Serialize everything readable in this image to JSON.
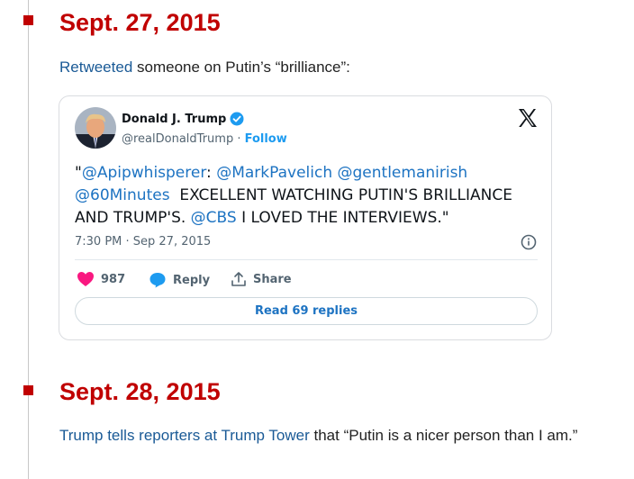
{
  "entries": [
    {
      "date": "Sept. 27, 2015",
      "link_text": "Retweeted",
      "text_after": " someone on Putin’s “brilliance”:"
    },
    {
      "date": "Sept. 28, 2015",
      "link_text": "Trump tells reporters at Trump Tower",
      "text_after": " that “Putin is a nicer person than I am.”"
    }
  ],
  "tweet": {
    "author_name": "Donald J. Trump",
    "handle": "@realDonaldTrump",
    "separator": " · ",
    "follow_label": "Follow",
    "text_open_quote": "\"",
    "mention_1": "@Apipwhisperer",
    "text_1": ": ",
    "mention_2": "@MarkPavelich",
    "text_2": " ",
    "mention_3": "@gentlemanirish",
    "text_3": " ",
    "mention_4": "@60Minutes",
    "text_4": "  EXCELLENT WATCHING PUTIN'S BRILLIANCE AND TRUMP'S. ",
    "mention_5": "@CBS",
    "text_5": " I LOVED THE INTERVIEWS.\"",
    "timestamp": "7:30 PM · Sep 27, 2015",
    "like_count": "987",
    "reply_label": "Reply",
    "share_label": "Share",
    "read_replies_label": "Read 69 replies"
  },
  "colors": {
    "date_red": "#c00000",
    "link_blue": "#1a5a96",
    "tweet_blue": "#1d9bf0",
    "like_pink": "#f91880"
  },
  "icons": [
    "verified-badge-icon",
    "x-logo-icon",
    "info-icon",
    "heart-icon",
    "reply-bubble-icon",
    "share-icon"
  ]
}
